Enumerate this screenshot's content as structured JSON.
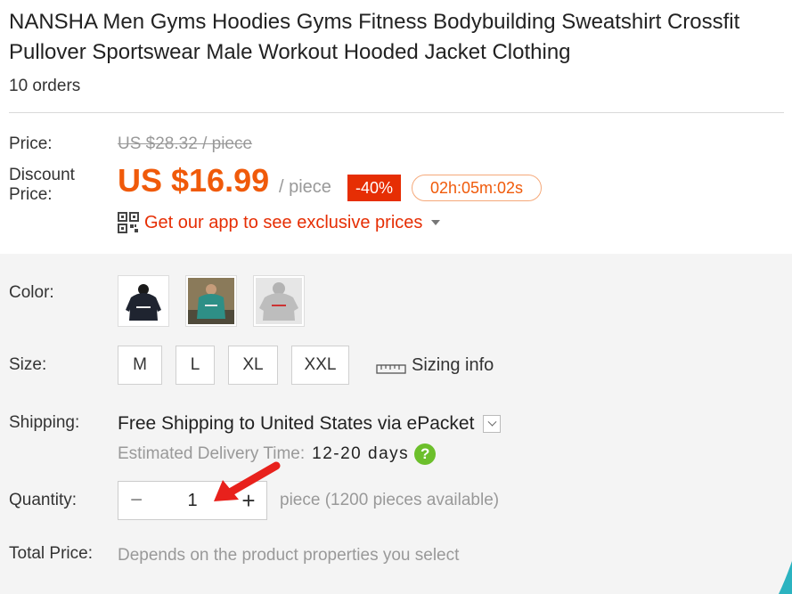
{
  "product": {
    "title": "NANSHA Men Gyms Hoodies Gyms Fitness Bodybuilding Sweatshirt Crossfit Pullover Sportswear Male Workout Hooded Jacket Clothing",
    "orders": "10 orders"
  },
  "price": {
    "label": "Price:",
    "original": "US $28.32 / piece",
    "discount_label": "Discount Price:",
    "discount": "US $16.99",
    "unit": "/ piece",
    "badge": "-40%",
    "countdown": "02h:05m:02s",
    "app_promo": "Get our app to see exclusive prices"
  },
  "color": {
    "label": "Color:",
    "options": [
      "black hoodie",
      "green hoodie",
      "gray hoodie"
    ]
  },
  "size": {
    "label": "Size:",
    "options": [
      "M",
      "L",
      "XL",
      "XXL"
    ],
    "sizing_info": "Sizing info"
  },
  "shipping": {
    "label": "Shipping:",
    "method_prefix": "Free Shipping to",
    "method_suffix": "United States via ePacket",
    "estimate_label": "Estimated Delivery Time:",
    "estimate_value": "12-20 days",
    "help": "?"
  },
  "quantity": {
    "label": "Quantity:",
    "value": "1",
    "minus": "−",
    "plus": "+",
    "available": "piece (1200 pieces available)"
  },
  "total": {
    "label": "Total Price:",
    "text": "Depends on the product properties you select"
  },
  "colors": {
    "accent": "#f05a0a",
    "badge": "#e62e04",
    "help": "#6cbf2b",
    "arrow": "#e8211c"
  }
}
